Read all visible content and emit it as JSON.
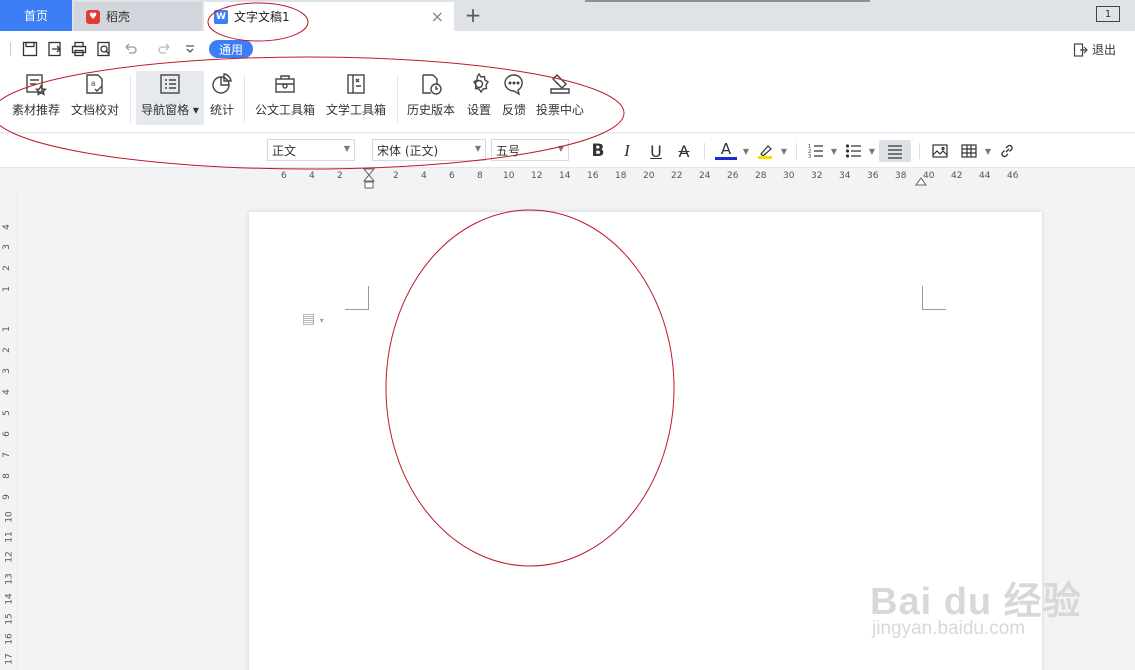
{
  "tabs": {
    "home": "首页",
    "daoke": "稻壳",
    "document": "文字文稿1",
    "add": "+",
    "close": "×"
  },
  "window": {
    "layout_label": "1"
  },
  "quick": {
    "mode_label": "通用",
    "exit_label": "退出"
  },
  "ribbon": {
    "items": [
      {
        "label": "素材推荐",
        "icon": "material-icon"
      },
      {
        "label": "文档校对",
        "icon": "proofread-icon"
      },
      {
        "label": "导航窗格",
        "icon": "nav-pane-icon"
      },
      {
        "label": "统计",
        "icon": "stats-icon"
      },
      {
        "label": "公文工具箱",
        "icon": "official-toolbox-icon"
      },
      {
        "label": "文学工具箱",
        "icon": "literary-toolbox-icon"
      },
      {
        "label": "历史版本",
        "icon": "history-icon"
      },
      {
        "label": "设置",
        "icon": "gear-icon"
      },
      {
        "label": "反馈",
        "icon": "feedback-icon"
      },
      {
        "label": "投票中心",
        "icon": "vote-icon"
      }
    ]
  },
  "format": {
    "style": "正文",
    "font": "宋体 (正文)",
    "size": "五号",
    "bold": "B",
    "italic": "I",
    "underline": "U",
    "strike": "A",
    "font_color": "A"
  },
  "ruler": {
    "h_ticks": [
      "6",
      "4",
      "2",
      "2",
      "4",
      "6",
      "8",
      "10",
      "12",
      "14",
      "16",
      "18",
      "20",
      "22",
      "24",
      "26",
      "28",
      "30",
      "32",
      "34",
      "36",
      "38",
      "40",
      "42",
      "44",
      "46"
    ],
    "v_ticks": [
      "4",
      "3",
      "2",
      "1",
      "1",
      "2",
      "3",
      "4",
      "5",
      "6",
      "7",
      "8",
      "9",
      "10",
      "11",
      "12",
      "13",
      "14",
      "15",
      "16",
      "17"
    ]
  },
  "watermark": {
    "brand": "Bai du 经验",
    "url": "jingyan.baidu.com"
  },
  "colors": {
    "accent": "#3b7ef5",
    "annotation": "#c0182a",
    "daoke": "#e53935"
  }
}
